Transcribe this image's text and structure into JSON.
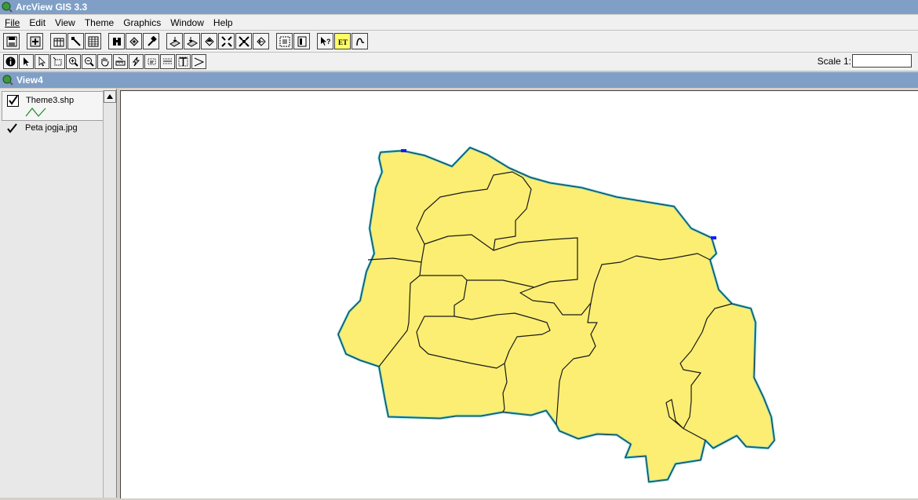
{
  "window": {
    "title": "ArcView GIS 3.3"
  },
  "menu": [
    "File",
    "Edit",
    "View",
    "Theme",
    "Graphics",
    "Window",
    "Help"
  ],
  "toolbar1": [
    "save-icon",
    "add-theme-icon",
    "gap",
    "table-icon",
    "edit-icon",
    "spreadsheet-icon",
    "gap",
    "find-icon",
    "locate-icon",
    "hammer-icon",
    "gap",
    "query-builder-icon",
    "select-icon",
    "zoom-to-themes-icon",
    "zoom-to-selected-icon",
    "zoom-full-icon",
    "zoom-previous-icon",
    "gap",
    "layout-icon",
    "print-icon",
    "gap",
    "help-icon",
    "et-icon",
    "hotlink-icon"
  ],
  "toolbar2": [
    "identify-icon",
    "pointer-icon",
    "vertex-edit-icon",
    "area-of-interest-icon",
    "zoom-in-icon",
    "zoom-out-icon",
    "pan-icon",
    "measure-icon",
    "hotlink-bolt-icon",
    "label-icon",
    "text-icon",
    "draw-text-icon",
    "draw-line-icon"
  ],
  "scale": {
    "label": "Scale 1:",
    "value": ""
  },
  "view": {
    "title": "View4"
  },
  "toc": {
    "themes": [
      {
        "name": "Theme3.shp",
        "visible": true
      },
      {
        "name": "Peta jogja.jpg",
        "visible": true
      }
    ]
  },
  "colors": {
    "title_bar": "#7f9fc6",
    "map_fill": "#fbee72",
    "map_outline": "#4bc3d6",
    "line_symbol": "#1a8a2a"
  }
}
